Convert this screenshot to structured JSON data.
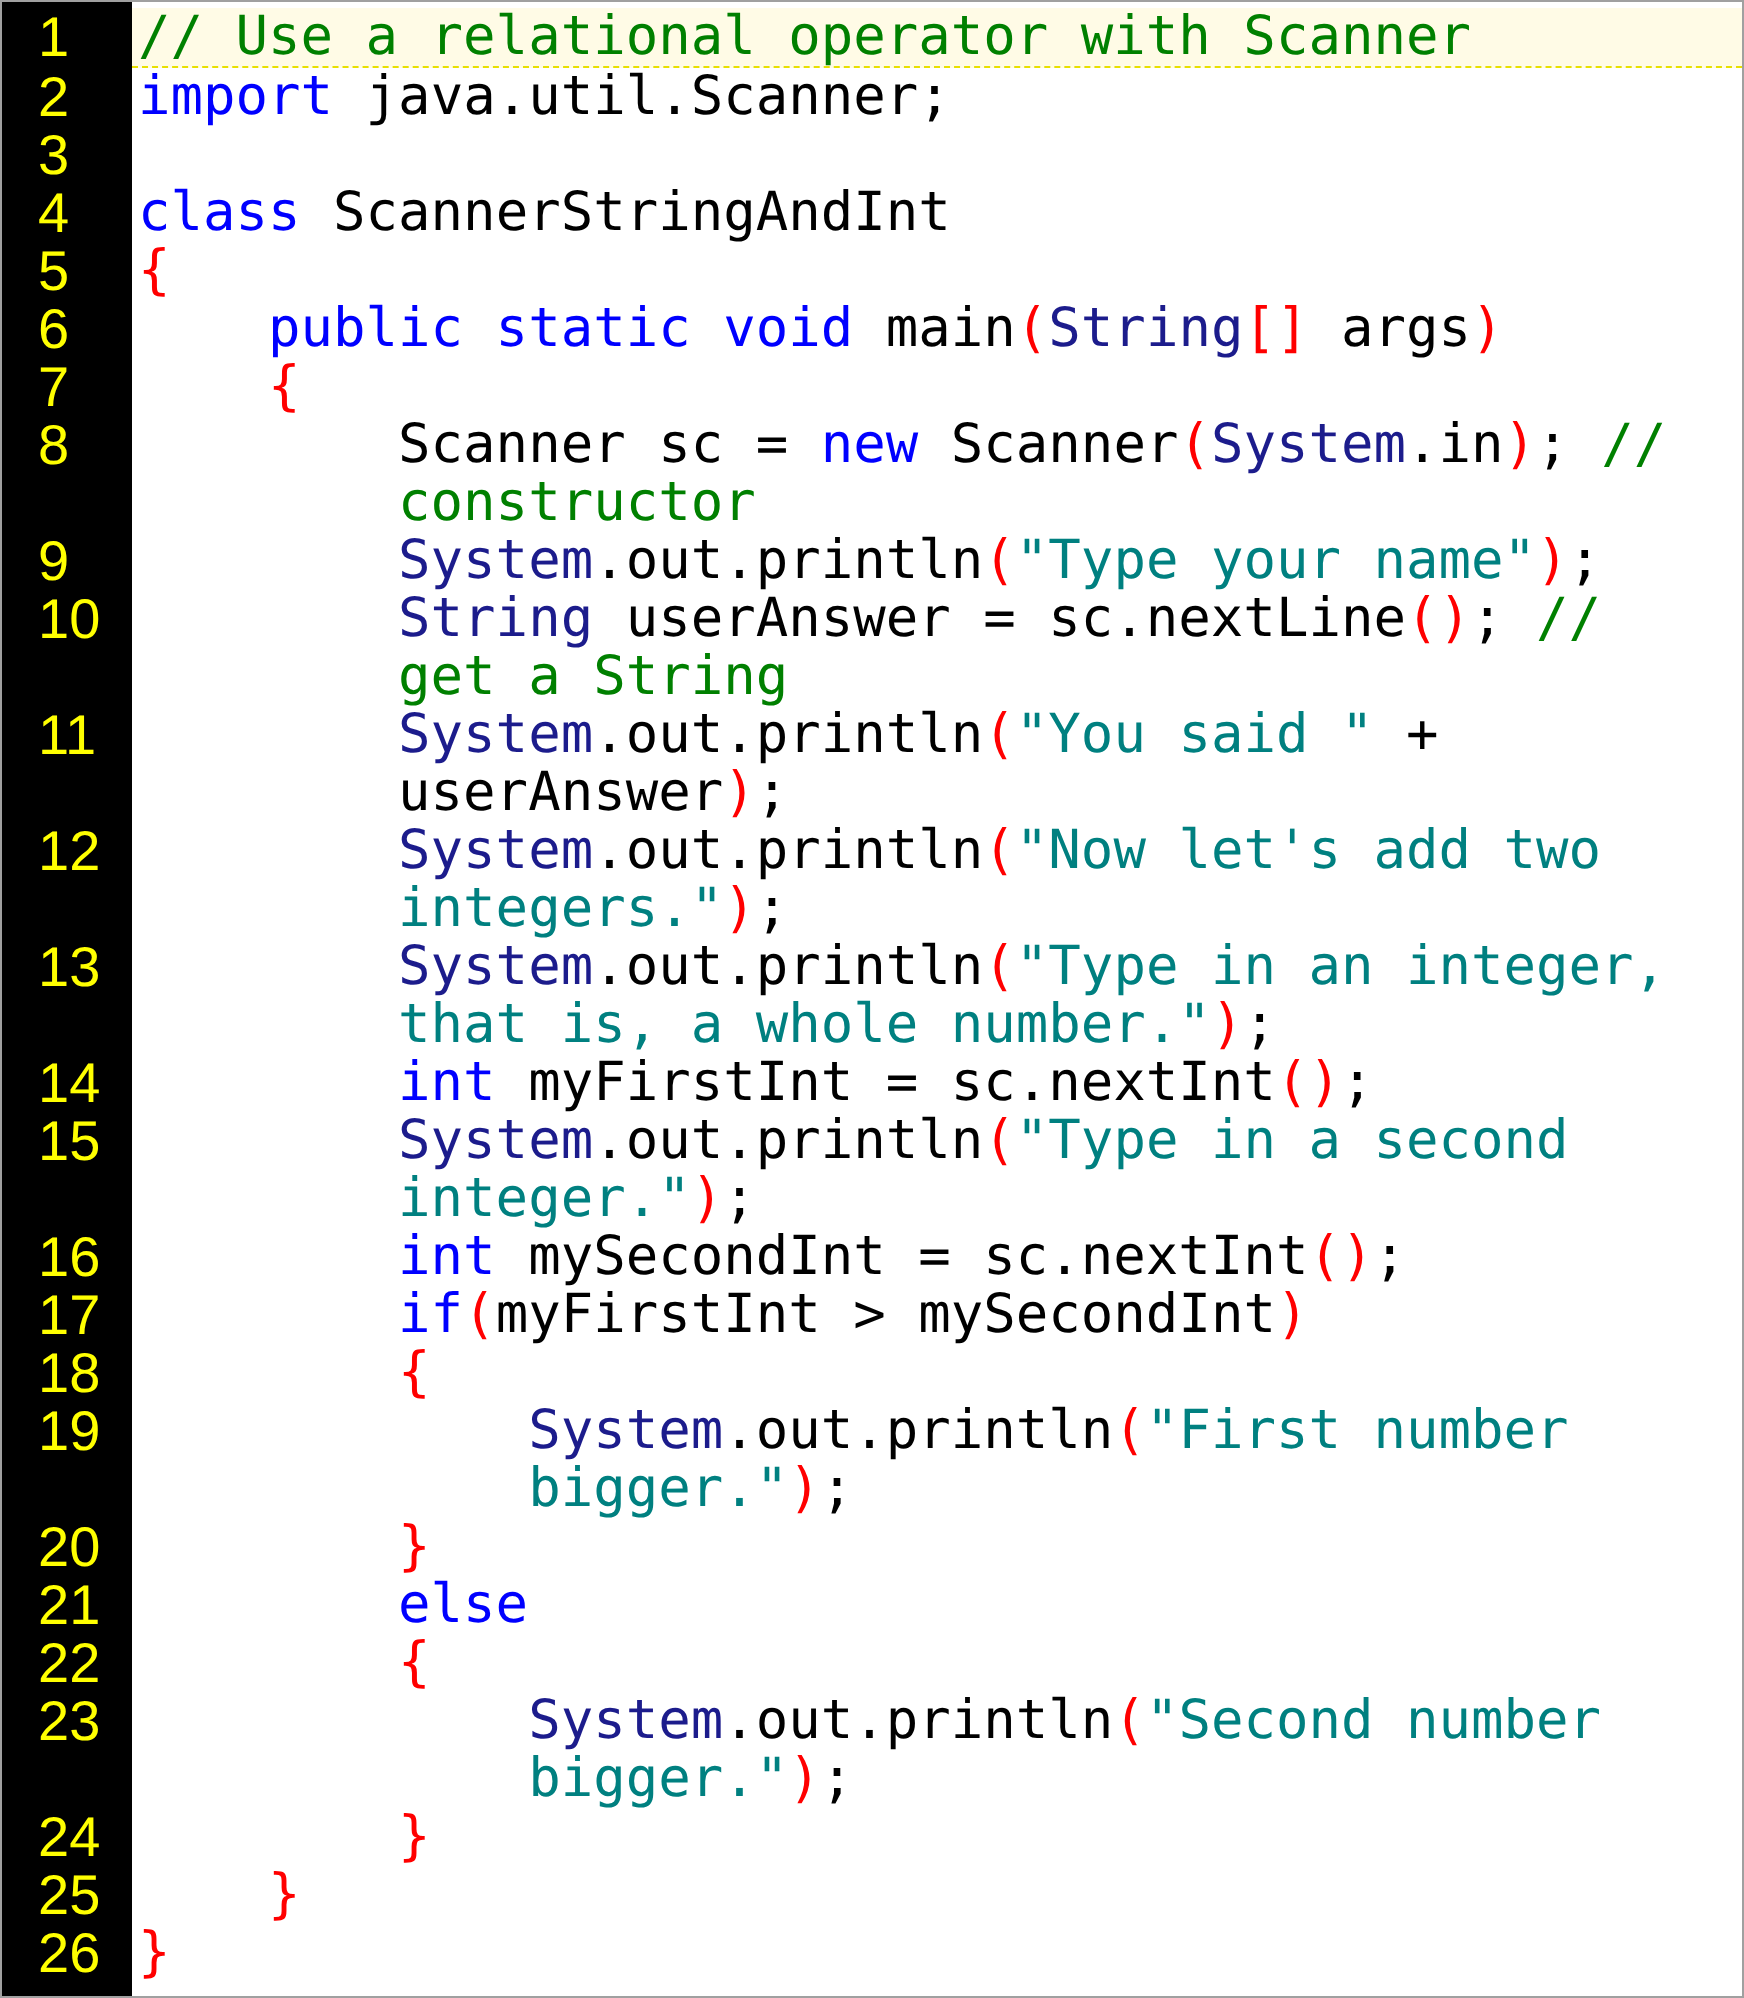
{
  "editor": {
    "lines": [
      {
        "number": "1",
        "current": true,
        "tokens": [
          {
            "kind": "comment",
            "text": "// Use a relational operator with Scanner"
          }
        ]
      },
      {
        "number": "2",
        "current": false,
        "tokens": [
          {
            "kind": "keyword",
            "text": "import"
          },
          {
            "kind": "plain",
            "text": " java.util.Scanner;"
          }
        ]
      },
      {
        "number": "3",
        "current": false
      },
      {
        "number": "4",
        "current": false,
        "tokens": [
          {
            "kind": "keyword",
            "text": "class"
          },
          {
            "kind": "plain",
            "text": " ScannerStringAndInt"
          }
        ]
      },
      {
        "number": "5",
        "current": false,
        "tokens": [
          {
            "kind": "bracket",
            "text": "{"
          }
        ]
      },
      {
        "number": "6",
        "current": false,
        "tokens": [
          {
            "kind": "keyword",
            "text": "    public static void"
          },
          {
            "kind": "plain",
            "text": " main"
          },
          {
            "kind": "bracket",
            "text": "("
          },
          {
            "kind": "type",
            "text": "String"
          },
          {
            "kind": "bracket",
            "text": "[]"
          },
          {
            "kind": "plain",
            "text": " args"
          },
          {
            "kind": "bracket",
            "text": ")"
          }
        ]
      },
      {
        "number": "7",
        "current": false,
        "tokens": [
          {
            "kind": "bracket",
            "text": "    {"
          }
        ]
      },
      {
        "number": "8",
        "current": false,
        "tokens": [
          {
            "kind": "plain",
            "text": "        Scanner sc = "
          },
          {
            "kind": "keyword",
            "text": "new"
          },
          {
            "kind": "plain",
            "text": " Scanner"
          },
          {
            "kind": "bracket",
            "text": "("
          },
          {
            "kind": "type",
            "text": "System"
          },
          {
            "kind": "plain",
            "text": ".in"
          },
          {
            "kind": "bracket",
            "text": ")"
          },
          {
            "kind": "plain",
            "text": "; "
          },
          {
            "kind": "comment",
            "text": "//"
          }
        ],
        "wrapped_tokens": [
          {
            "kind": "comment",
            "text": "        constructor"
          }
        ]
      },
      {
        "number": "9",
        "current": false,
        "tokens": [
          {
            "kind": "type",
            "text": "        System"
          },
          {
            "kind": "plain",
            "text": ".out.println"
          },
          {
            "kind": "bracket",
            "text": "("
          },
          {
            "kind": "string",
            "text": "\"Type your name\""
          },
          {
            "kind": "bracket",
            "text": ")"
          },
          {
            "kind": "plain",
            "text": ";"
          }
        ]
      },
      {
        "number": "10",
        "current": false,
        "tokens": [
          {
            "kind": "type",
            "text": "        String"
          },
          {
            "kind": "plain",
            "text": " userAnswer = sc.nextLine"
          },
          {
            "kind": "bracket",
            "text": "()"
          },
          {
            "kind": "plain",
            "text": "; "
          },
          {
            "kind": "comment",
            "text": "//"
          }
        ],
        "wrapped_tokens": [
          {
            "kind": "comment",
            "text": "        get a String"
          }
        ]
      },
      {
        "number": "11",
        "current": false,
        "tokens": [
          {
            "kind": "type",
            "text": "        System"
          },
          {
            "kind": "plain",
            "text": ".out.println"
          },
          {
            "kind": "bracket",
            "text": "("
          },
          {
            "kind": "string",
            "text": "\"You said \""
          },
          {
            "kind": "plain",
            "text": " +"
          }
        ],
        "wrapped_tokens": [
          {
            "kind": "plain",
            "text": "        userAnswer"
          },
          {
            "kind": "bracket",
            "text": ")"
          },
          {
            "kind": "plain",
            "text": ";"
          }
        ]
      },
      {
        "number": "12",
        "current": false,
        "tokens": [
          {
            "kind": "type",
            "text": "        System"
          },
          {
            "kind": "plain",
            "text": ".out.println"
          },
          {
            "kind": "bracket",
            "text": "("
          },
          {
            "kind": "string",
            "text": "\"Now let's add two"
          }
        ],
        "wrapped_tokens": [
          {
            "kind": "string",
            "text": "        integers.\""
          },
          {
            "kind": "bracket",
            "text": ")"
          },
          {
            "kind": "plain",
            "text": ";"
          }
        ]
      },
      {
        "number": "13",
        "current": false,
        "tokens": [
          {
            "kind": "type",
            "text": "        System"
          },
          {
            "kind": "plain",
            "text": ".out.println"
          },
          {
            "kind": "bracket",
            "text": "("
          },
          {
            "kind": "string",
            "text": "\"Type in an integer,"
          }
        ],
        "wrapped_tokens": [
          {
            "kind": "string",
            "text": "        that is, a whole number.\""
          },
          {
            "kind": "bracket",
            "text": ")"
          },
          {
            "kind": "plain",
            "text": ";"
          }
        ]
      },
      {
        "number": "14",
        "current": false,
        "tokens": [
          {
            "kind": "keyword",
            "text": "        int"
          },
          {
            "kind": "plain",
            "text": " myFirstInt = sc.nextInt"
          },
          {
            "kind": "bracket",
            "text": "()"
          },
          {
            "kind": "plain",
            "text": ";"
          }
        ]
      },
      {
        "number": "15",
        "current": false,
        "tokens": [
          {
            "kind": "type",
            "text": "        System"
          },
          {
            "kind": "plain",
            "text": ".out.println"
          },
          {
            "kind": "bracket",
            "text": "("
          },
          {
            "kind": "string",
            "text": "\"Type in a second"
          }
        ],
        "wrapped_tokens": [
          {
            "kind": "string",
            "text": "        integer.\""
          },
          {
            "kind": "bracket",
            "text": ")"
          },
          {
            "kind": "plain",
            "text": ";"
          }
        ]
      },
      {
        "number": "16",
        "current": false,
        "tokens": [
          {
            "kind": "keyword",
            "text": "        int"
          },
          {
            "kind": "plain",
            "text": " mySecondInt = sc.nextInt"
          },
          {
            "kind": "bracket",
            "text": "()"
          },
          {
            "kind": "plain",
            "text": ";"
          }
        ]
      },
      {
        "number": "17",
        "current": false,
        "tokens": [
          {
            "kind": "keyword",
            "text": "        if"
          },
          {
            "kind": "bracket",
            "text": "("
          },
          {
            "kind": "plain",
            "text": "myFirstInt > mySecondInt"
          },
          {
            "kind": "bracket",
            "text": ")"
          }
        ]
      },
      {
        "number": "18",
        "current": false,
        "tokens": [
          {
            "kind": "bracket",
            "text": "        {"
          }
        ]
      },
      {
        "number": "19",
        "current": false,
        "tokens": [
          {
            "kind": "type",
            "text": "            System"
          },
          {
            "kind": "plain",
            "text": ".out.println"
          },
          {
            "kind": "bracket",
            "text": "("
          },
          {
            "kind": "string",
            "text": "\"First number"
          }
        ],
        "wrapped_tokens": [
          {
            "kind": "string",
            "text": "            bigger.\""
          },
          {
            "kind": "bracket",
            "text": ")"
          },
          {
            "kind": "plain",
            "text": ";"
          }
        ]
      },
      {
        "number": "20",
        "current": false,
        "tokens": [
          {
            "kind": "bracket",
            "text": "        }"
          }
        ]
      },
      {
        "number": "21",
        "current": false,
        "tokens": [
          {
            "kind": "keyword",
            "text": "        else"
          }
        ]
      },
      {
        "number": "22",
        "current": false,
        "tokens": [
          {
            "kind": "bracket",
            "text": "        {"
          }
        ]
      },
      {
        "number": "23",
        "current": false,
        "tokens": [
          {
            "kind": "type",
            "text": "            System"
          },
          {
            "kind": "plain",
            "text": ".out.println"
          },
          {
            "kind": "bracket",
            "text": "("
          },
          {
            "kind": "string",
            "text": "\"Second number"
          }
        ],
        "wrapped_tokens": [
          {
            "kind": "string",
            "text": "            bigger.\""
          },
          {
            "kind": "bracket",
            "text": ")"
          },
          {
            "kind": "plain",
            "text": ";"
          }
        ]
      },
      {
        "number": "24",
        "current": false,
        "tokens": [
          {
            "kind": "bracket",
            "text": "        }"
          }
        ]
      },
      {
        "number": "25",
        "current": false,
        "tokens": [
          {
            "kind": "bracket",
            "text": "    }"
          }
        ]
      },
      {
        "number": "26",
        "current": false,
        "tokens": [
          {
            "kind": "bracket",
            "text": "}"
          }
        ]
      }
    ]
  }
}
